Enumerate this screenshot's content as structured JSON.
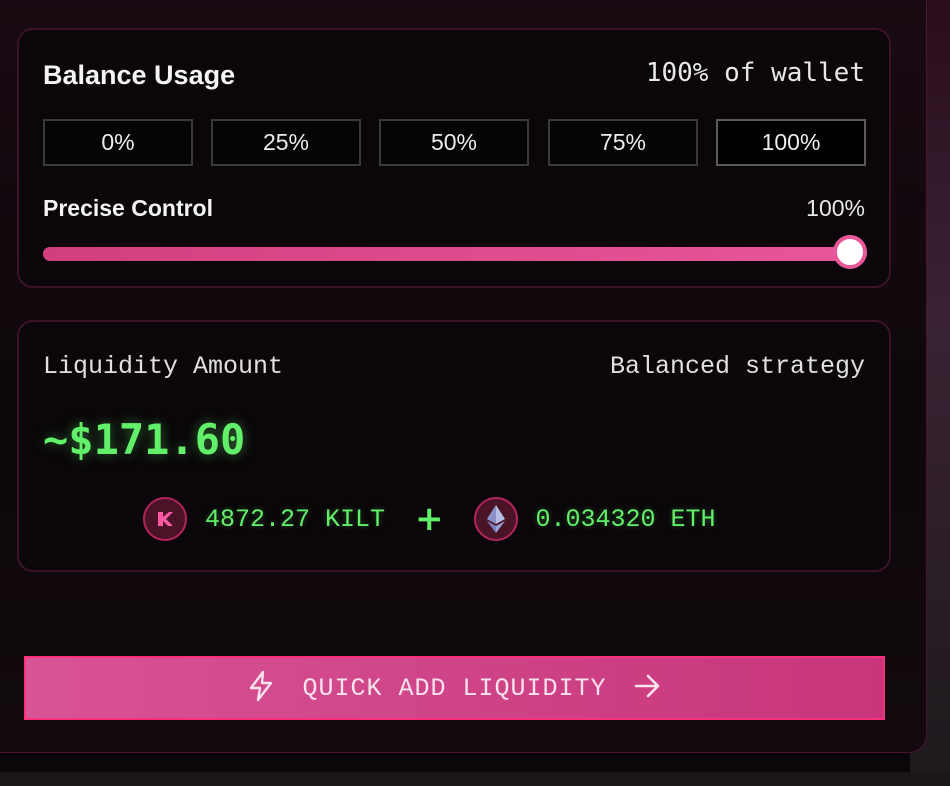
{
  "balance_usage": {
    "title": "Balance Usage",
    "value": "100% of wallet",
    "presets": [
      "0%",
      "25%",
      "50%",
      "75%",
      "100%"
    ],
    "selected_preset": "100%",
    "precise_control_label": "Precise Control",
    "precise_control_value": "100%",
    "slider_fraction": 1.0
  },
  "liquidity": {
    "title": "Liquidity Amount",
    "strategy": "Balanced strategy",
    "amount": "~$171.60",
    "token_a": {
      "icon": "kilt-icon",
      "amount": "4872.27 KILT"
    },
    "plus": "+",
    "token_b": {
      "icon": "eth-icon",
      "amount": "0.034320 ETH"
    }
  },
  "cta": {
    "label": "QUICK ADD LIQUIDITY",
    "left_icon": "lightning-icon",
    "right_icon": "arrow-right-icon"
  },
  "colors": {
    "accent_pink": "#e8579a",
    "amount_green": "#62f06a",
    "card_border": "#3d1228"
  }
}
